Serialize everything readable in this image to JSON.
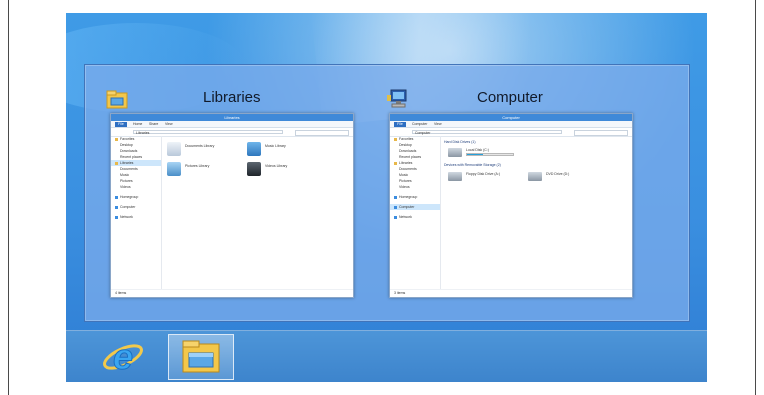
{
  "switcher": {
    "windows": [
      {
        "title": "Libraries",
        "icon": "libraries-folder-icon",
        "thumbnail": {
          "titlebar": "Libraries",
          "tabs": [
            "File",
            "Home",
            "Share",
            "View"
          ],
          "address": "Libraries",
          "nav": [
            "Favorites",
            "Desktop",
            "Downloads",
            "Recent places",
            "Libraries",
            "Documents",
            "Music",
            "Pictures",
            "Videos",
            "Homegroup",
            "Computer",
            "Network"
          ],
          "items": [
            "Documents Library",
            "Music Library",
            "Pictures Library",
            "Videos Library"
          ],
          "status": "4 items"
        }
      },
      {
        "title": "Computer",
        "icon": "computer-icon",
        "thumbnail": {
          "titlebar": "Computer",
          "tabs": [
            "File",
            "Computer",
            "View"
          ],
          "address": "Computer",
          "nav": [
            "Favorites",
            "Desktop",
            "Downloads",
            "Recent places",
            "Libraries",
            "Documents",
            "Music",
            "Pictures",
            "Videos",
            "Homegroup",
            "Computer",
            "Network"
          ],
          "groups": [
            "Hard Disk Drives (1)",
            "Devices with Removable Storage (2)"
          ],
          "drives": [
            "Local Disk (C:)",
            "Floppy Disk Drive (A:)",
            "DVD Drive (D:)"
          ],
          "status": "3 items"
        }
      }
    ]
  },
  "taskbar": {
    "items": [
      {
        "name": "Internet Explorer",
        "icon": "internet-explorer-icon",
        "active": false
      },
      {
        "name": "File Explorer",
        "icon": "file-explorer-icon",
        "active": true
      }
    ]
  },
  "colors": {
    "desktop": "#3a8fe0",
    "taskbar": "#4a90d6",
    "switcher_overlay": "#78aaeb"
  }
}
